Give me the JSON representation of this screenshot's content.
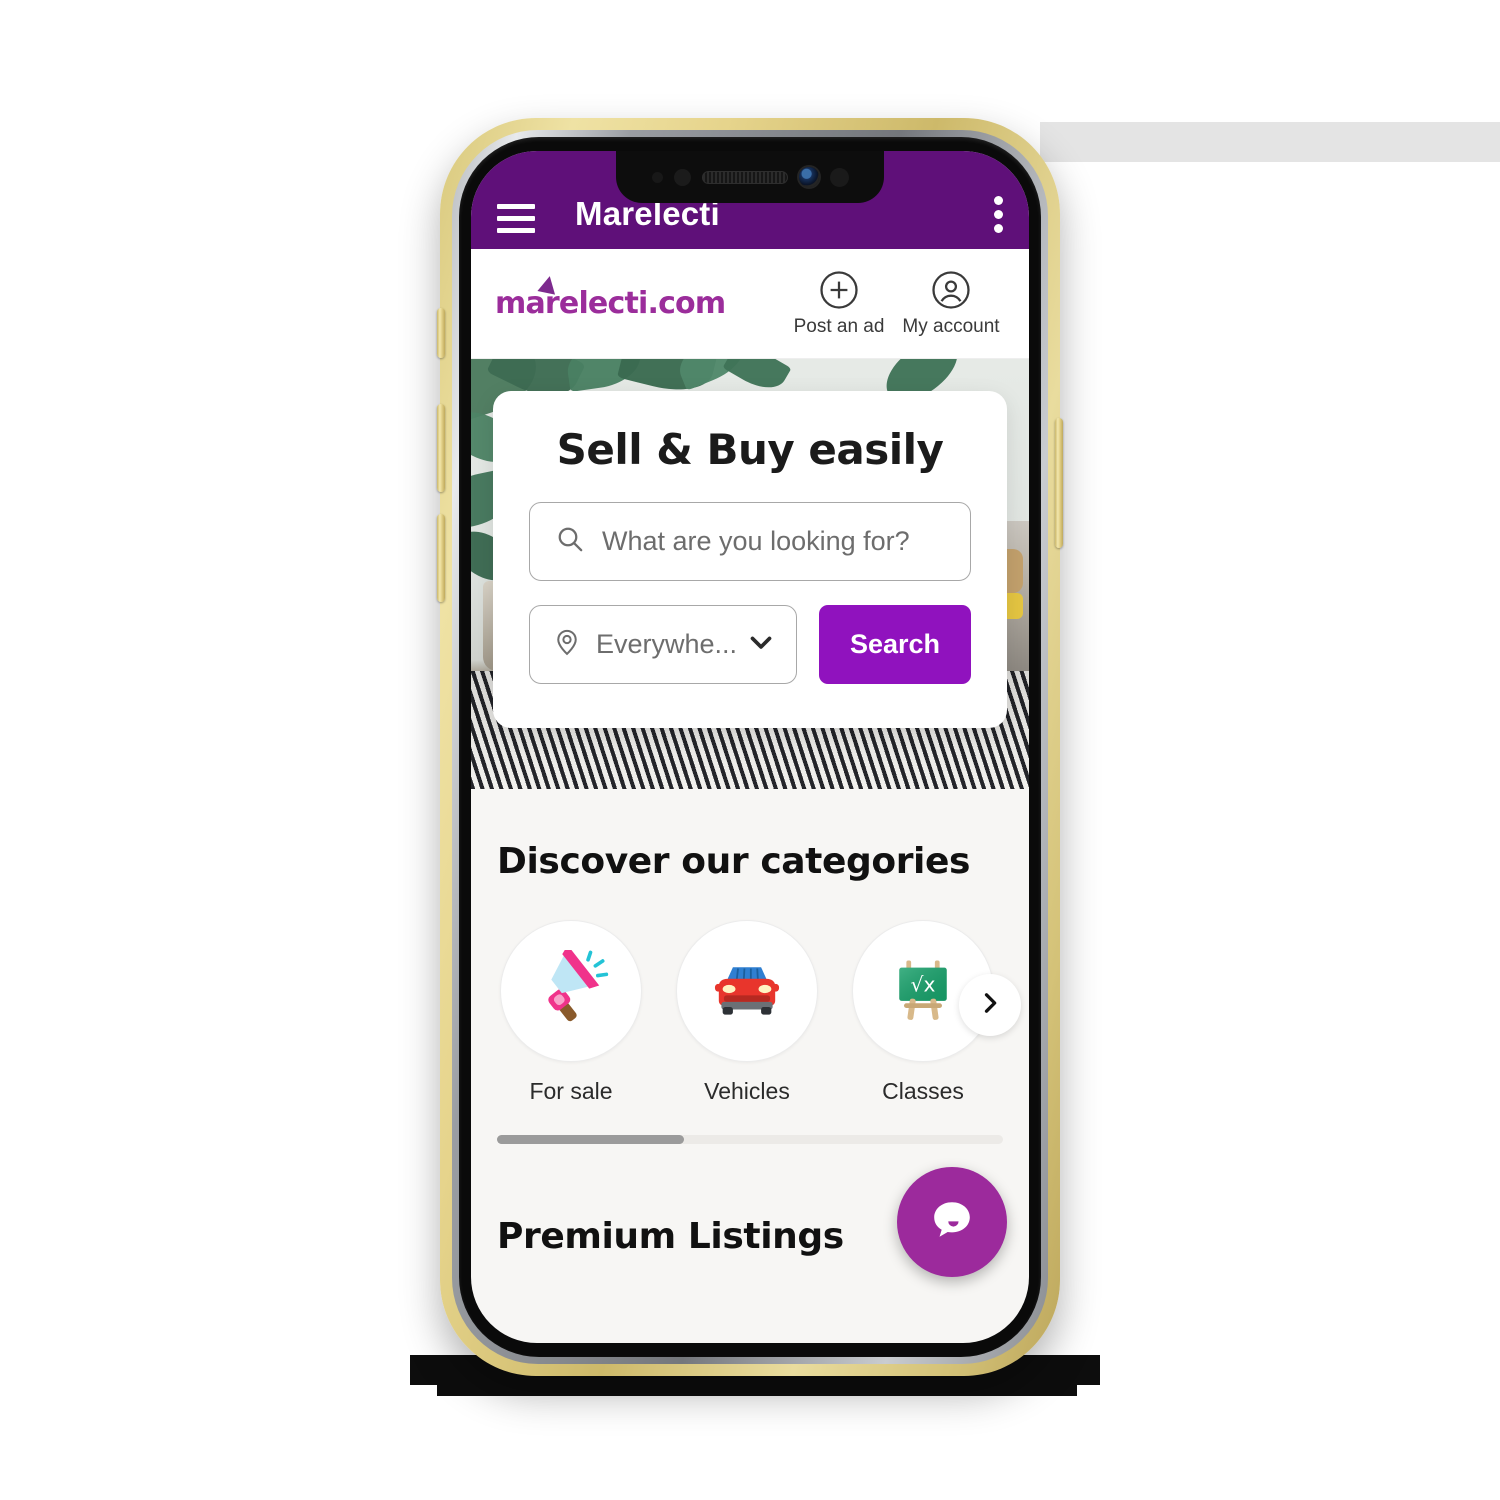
{
  "appbar": {
    "title": "Marelecti",
    "menu_icon": "hamburger-menu-icon",
    "overflow_icon": "kebab-menu-icon"
  },
  "site_header": {
    "logo_text": "marelecti.com",
    "actions": [
      {
        "label": "Post an ad",
        "icon": "plus-circle-icon"
      },
      {
        "label": "My account",
        "icon": "account-circle-icon"
      }
    ]
  },
  "hero": {
    "title": "Sell & Buy easily",
    "search_placeholder": "What are you looking for?",
    "search_icon": "search-icon",
    "location_value": "Everywhe...",
    "location_icon": "map-pin-icon",
    "location_chevron": "chevron-down-icon",
    "search_button": "Search"
  },
  "categories": {
    "section_title": "Discover our categories",
    "next_icon": "chevron-right-icon",
    "items": [
      {
        "label": "For sale",
        "icon": "megaphone-icon"
      },
      {
        "label": "Vehicles",
        "icon": "car-icon"
      },
      {
        "label": "Classes",
        "icon": "chalkboard-icon"
      }
    ],
    "scroll_progress": "37%"
  },
  "premium": {
    "section_title": "Premium Listings"
  },
  "chat": {
    "icon": "chat-bubble-icon"
  },
  "colors": {
    "appbar_purple": "#5f1079",
    "brand_purple": "#9012be",
    "logo_purple": "#9b2d9b",
    "fab_purple": "#9c2a9c",
    "page_bg": "#f7f6f4",
    "device_gold": "#e0cf86"
  }
}
